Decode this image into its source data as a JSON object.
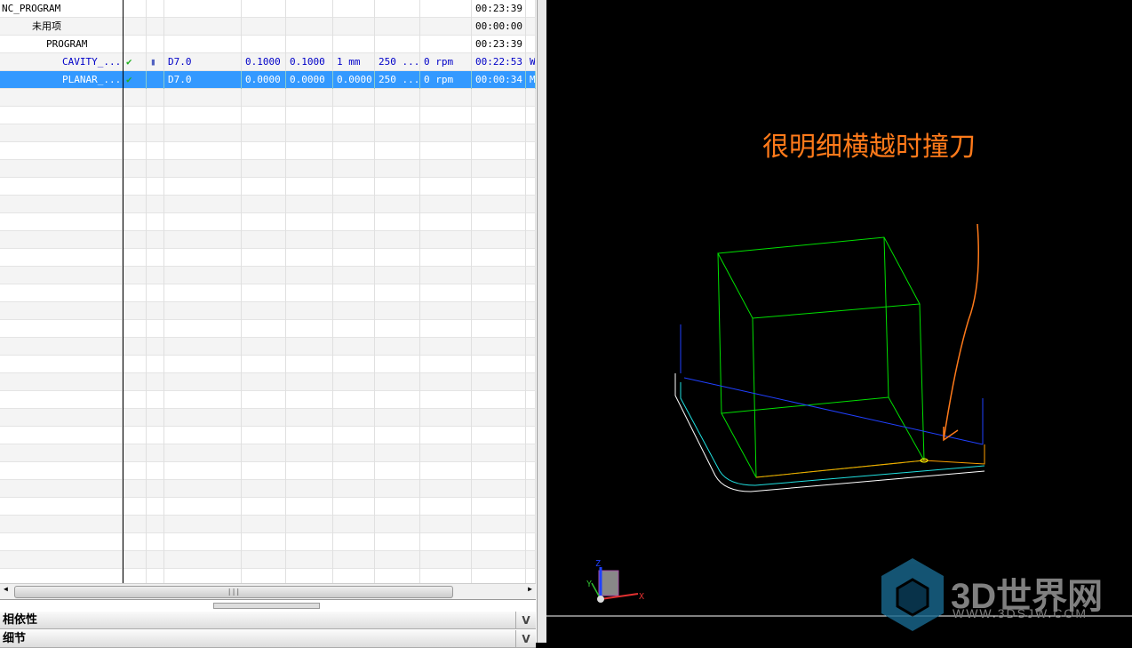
{
  "tree": {
    "rows": [
      {
        "name": "NC_PROGRAM",
        "time": "00:23:39"
      },
      {
        "name": "未用项",
        "time": "00:00:00"
      },
      {
        "name": "PROGRAM",
        "time": "00:23:39"
      },
      {
        "name": "CAVITY_...",
        "check": "✔",
        "tool": "D7.0",
        "c1": "0.1000",
        "c2": "0.1000",
        "c3": "1 mm",
        "c4": "250 ...",
        "c5": "0 rpm",
        "time": "00:22:53",
        "extra": "W"
      },
      {
        "name": "PLANAR_...",
        "check": "✔",
        "tool": "D7.0",
        "c1": "0.0000",
        "c2": "0.0000",
        "c3": "0.0000",
        "c4": "250 ...",
        "c5": "0 rpm",
        "time": "00:00:34",
        "extra": "M"
      }
    ]
  },
  "scroll_grip": "|||",
  "sections": {
    "dependencies": "相依性",
    "details": "细节"
  },
  "viewport": {
    "annotation": "很明细横越时撞刀",
    "annotation_color": "#ff7a1a",
    "axis": {
      "x": "X",
      "y": "Y",
      "z": "Z"
    }
  },
  "watermark": {
    "brand": "3D世界网",
    "url": "WWW.3DSJW.COM"
  }
}
